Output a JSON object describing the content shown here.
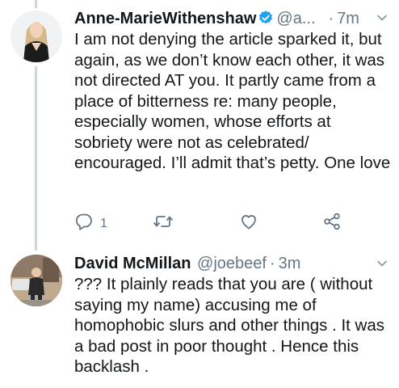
{
  "tweets": [
    {
      "author_name": "Anne-MarieWithenshaw",
      "handle": "@a...",
      "separator": "·",
      "time": "7m",
      "verified": true,
      "text": "I am not denying the article sparked it, but again, as we don’t know each other, it was not directed AT you. It partly came from a place of bitterness re: many people, especially women, whose efforts at sobriety were not as celebrated/ encouraged. I’ll admit that’s petty. One love",
      "reply_count": "1",
      "icons": [
        "reply-icon",
        "retweet-icon",
        "like-icon",
        "share-icon",
        "chevron-down-icon",
        "verified-badge-icon"
      ]
    },
    {
      "author_name": "David McMillan",
      "handle": "@joebeef",
      "separator": "·",
      "time": "3m",
      "text": "??? It plainly reads that you are ( without saying my name) accusing me of homophobic slurs and other things . It was a bad post in poor thought . Hence this backlash .",
      "icons": [
        "chevron-down-icon"
      ]
    }
  ],
  "colors": {
    "text": "#14171a",
    "secondary": "#657786",
    "verified": "#1da1f2",
    "thread_line": "#ccd6dd"
  }
}
